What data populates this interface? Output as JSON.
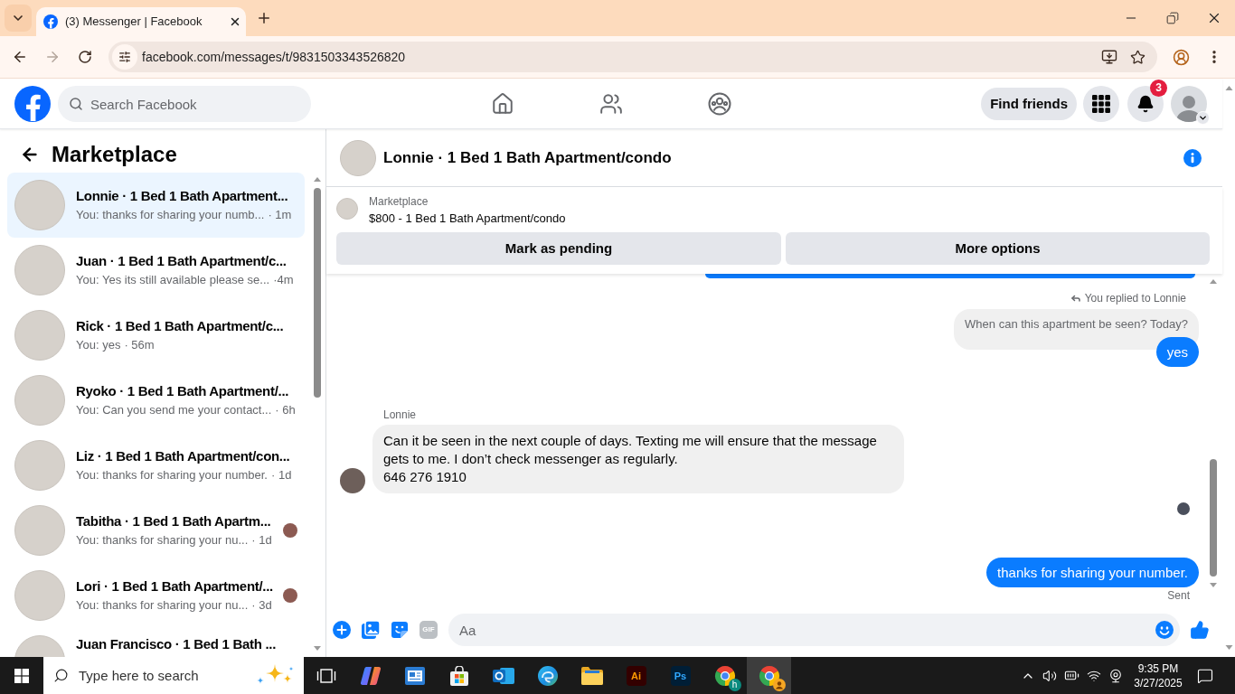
{
  "browser": {
    "tab_title": "(3) Messenger | Facebook",
    "url": "facebook.com/messages/t/9831503343526820"
  },
  "header": {
    "search_placeholder": "Search Facebook",
    "find_friends": "Find friends",
    "notification_count": "3"
  },
  "sidebar": {
    "title": "Marketplace",
    "conversations": [
      {
        "name": "Lonnie · 1 Bed 1 Bath Apartment...",
        "preview": "You: thanks for sharing your numb...",
        "time": "· 1m",
        "selected": true,
        "seen": false
      },
      {
        "name": "Juan · 1 Bed 1 Bath Apartment/c...",
        "preview": "You: Yes its still available please se...",
        "time": "·4m",
        "selected": false,
        "seen": false
      },
      {
        "name": "Rick · 1 Bed 1 Bath Apartment/c...",
        "preview": "You: yes",
        "time": "· 56m",
        "selected": false,
        "seen": false
      },
      {
        "name": "Ryoko · 1 Bed 1 Bath Apartment/...",
        "preview": "You: Can you send me your contact...",
        "time": "· 6h",
        "selected": false,
        "seen": false
      },
      {
        "name": "Liz · 1 Bed 1 Bath Apartment/con...",
        "preview": "You: thanks for sharing your number.",
        "time": "· 1d",
        "selected": false,
        "seen": false
      },
      {
        "name": "Tabitha · 1 Bed 1 Bath Apartm...",
        "preview": "You: thanks for sharing your nu...",
        "time": "· 1d",
        "selected": false,
        "seen": true
      },
      {
        "name": "Lori · 1 Bed 1 Bath Apartment/...",
        "preview": "You: thanks for sharing your nu...",
        "time": "· 3d",
        "selected": false,
        "seen": true
      },
      {
        "name": "Juan Francisco · 1 Bed 1 Bath ...",
        "selected": false,
        "seen": false
      }
    ]
  },
  "chat": {
    "title": "Lonnie · 1 Bed 1 Bath Apartment/condo",
    "listing": {
      "source": "Marketplace",
      "title": "$800 - 1 Bed 1 Bath Apartment/condo",
      "actions": [
        "Mark as pending",
        "More options"
      ]
    },
    "messages": [
      {
        "kind": "reply_note",
        "text": "You replied to Lonnie"
      },
      {
        "kind": "quote",
        "text": "When can this apartment be seen? Today?"
      },
      {
        "kind": "outgoing",
        "text": "yes"
      },
      {
        "kind": "sender",
        "text": "Lonnie"
      },
      {
        "kind": "incoming",
        "text": "Can it be seen in the next couple of days. Texting me will ensure that the message gets to me. I don’t check messenger as regularly.\n646 276 1910"
      },
      {
        "kind": "seen"
      },
      {
        "kind": "outgoing",
        "text": "thanks for sharing your number."
      },
      {
        "kind": "status",
        "text": "Sent"
      }
    ],
    "composer": {
      "gif_label": "GIF",
      "placeholder": "Aa"
    }
  },
  "taskbar": {
    "search_placeholder": "Type here to search",
    "apps": [
      {
        "kind": "task_view",
        "selected": false
      },
      {
        "kind": "copilot",
        "selected": false
      },
      {
        "kind": "news",
        "selected": false
      },
      {
        "kind": "store",
        "selected": false
      },
      {
        "kind": "outlook",
        "selected": false
      },
      {
        "kind": "edge",
        "selected": false
      },
      {
        "kind": "files",
        "selected": false
      },
      {
        "kind": "illustrator",
        "label": "Ai",
        "selected": false
      },
      {
        "kind": "photoshop",
        "label": "Ps",
        "selected": false
      },
      {
        "kind": "chrome",
        "badge": "h",
        "selected": false
      },
      {
        "kind": "chrome_profile",
        "selected": true
      }
    ],
    "time": "9:35 PM",
    "date": "3/27/2025"
  }
}
